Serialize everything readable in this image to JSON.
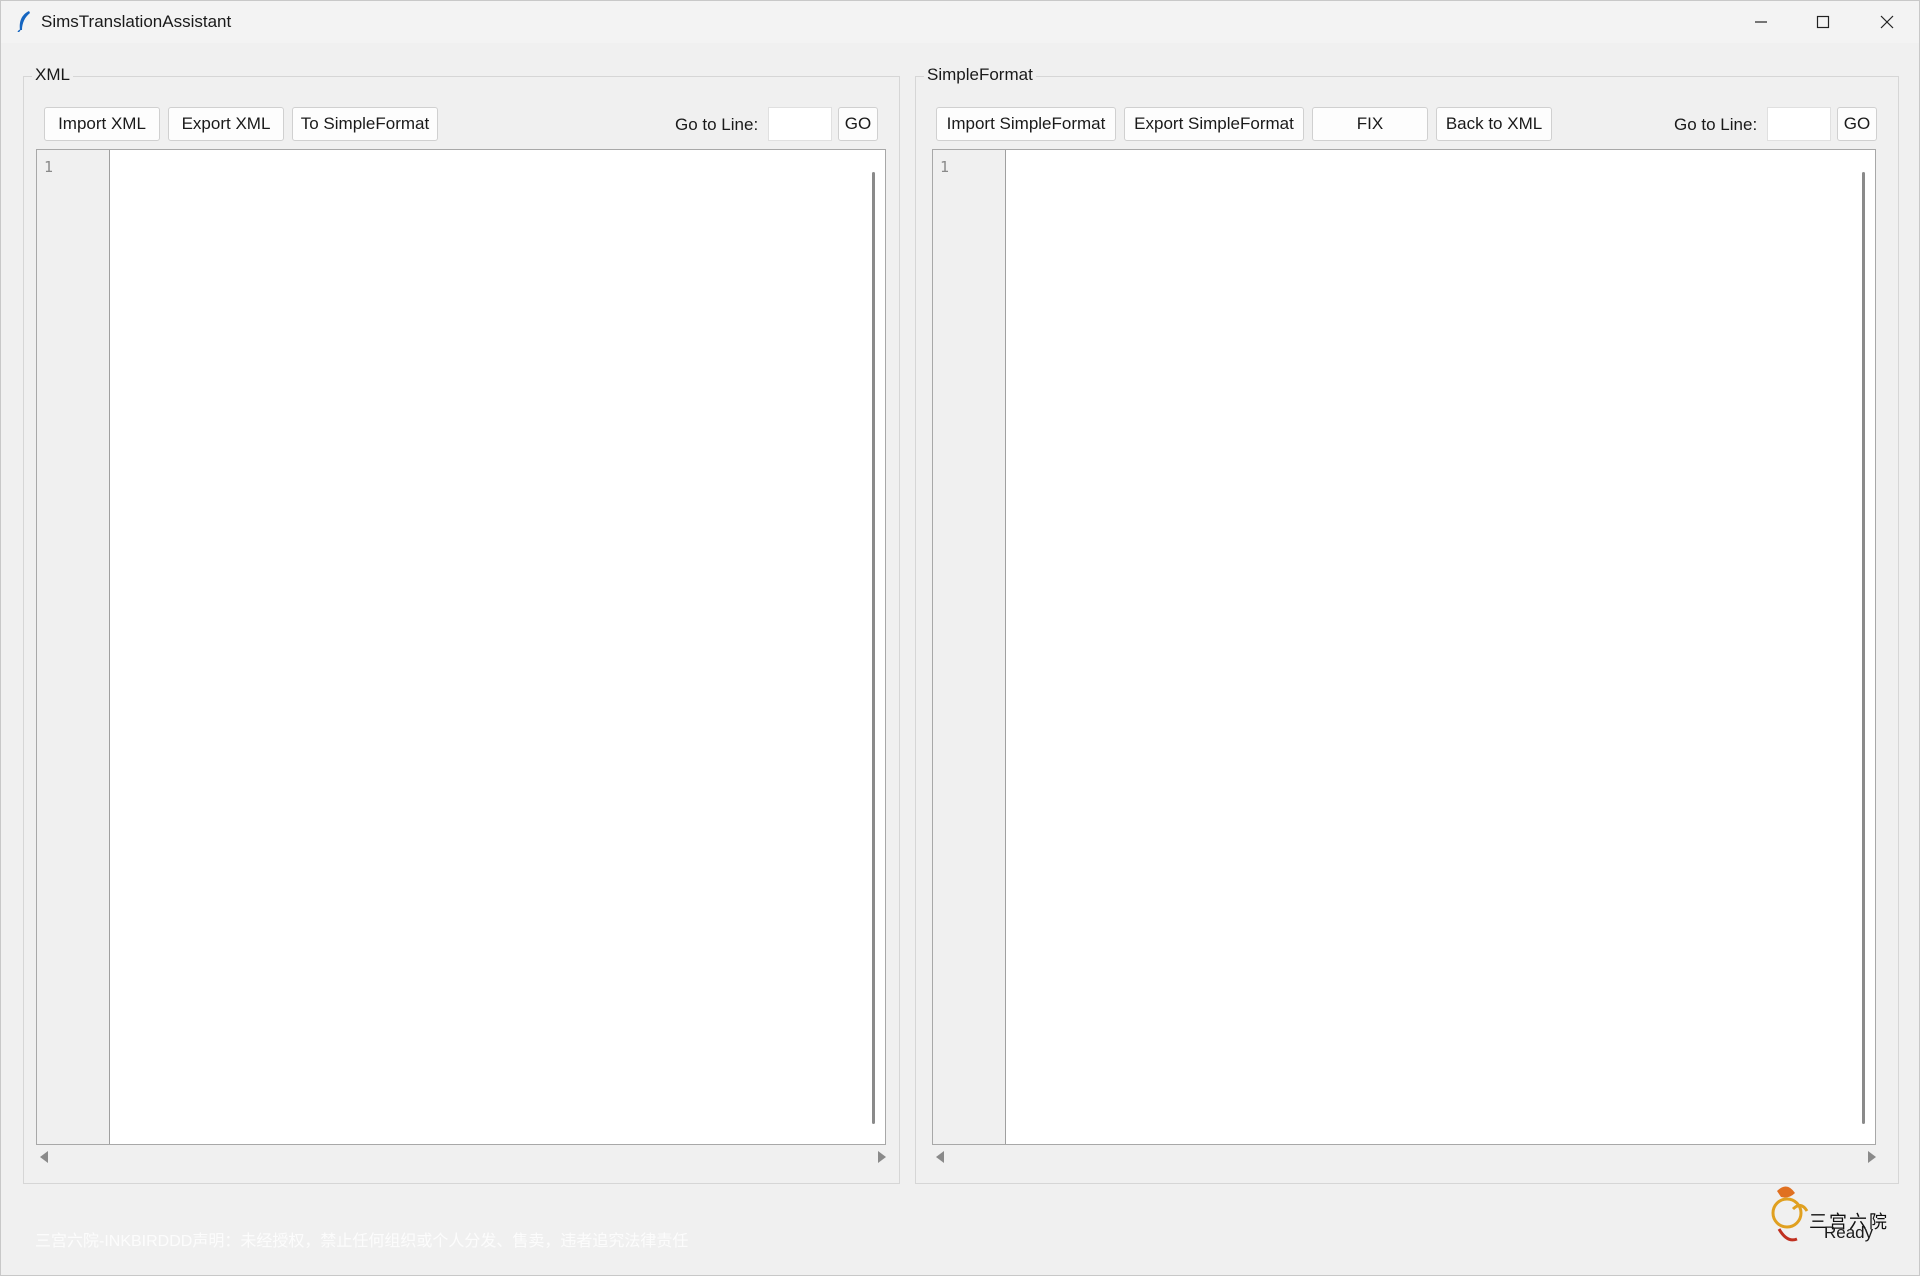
{
  "window": {
    "title": "SimsTranslationAssistant",
    "controls": {
      "minimize": "—",
      "maximize": "☐",
      "close": "✕"
    }
  },
  "xml_panel": {
    "label": "XML",
    "buttons": {
      "import": "Import XML",
      "export": "Export XML",
      "convert": "To SimpleFormat"
    },
    "goto_label": "Go to Line:",
    "goto_value": "",
    "go_button": "GO",
    "line_numbers": [
      "1"
    ]
  },
  "sf_panel": {
    "label": "SimpleFormat",
    "buttons": {
      "import": "Import SimpleFormat",
      "export": "Export SimpleFormat",
      "fix": "FIX",
      "back": "Back to XML"
    },
    "goto_label": "Go to Line:",
    "goto_value": "",
    "go_button": "GO",
    "line_numbers": [
      "1"
    ]
  },
  "footer": {
    "watermark": "三宫六院-INKBIRDDD声明：未经授权，禁止任何组织或个人分发、售卖，违者追究法律责任",
    "status": "Ready",
    "logo_text": "三宫六院"
  },
  "colors": {
    "background": "#f0f0f0",
    "editor": "#ffffff",
    "accent": "#1565c0"
  }
}
